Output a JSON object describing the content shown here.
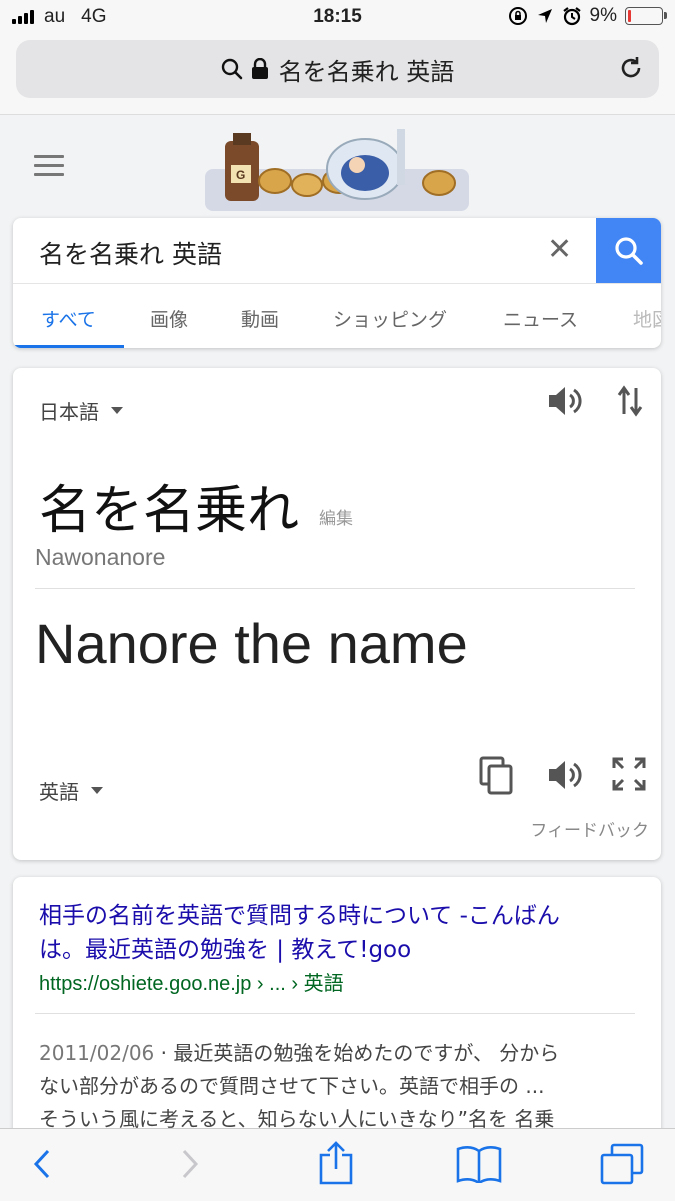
{
  "status": {
    "carrier": "au",
    "network": "4G",
    "time": "18:15",
    "battery": "9%"
  },
  "url_bar": {
    "text": "名を名乗れ 英語"
  },
  "search": {
    "query": "名を名乗れ 英語"
  },
  "tabs": [
    "すべて",
    "画像",
    "動画",
    "ショッピング",
    "ニュース",
    "地図"
  ],
  "translate": {
    "source_lang": "日本語",
    "source_text": "名を名乗れ",
    "edit_label": "編集",
    "romanization": "Nawonanore",
    "target_text": "Nanore the name",
    "target_lang": "英語",
    "feedback": "フィードバック"
  },
  "result": {
    "title_line1": "相手の名前を英語で質問する時について -こんばん",
    "title_line2": "は。最近英語の勉強を | 教えて!goo",
    "url_host": "https://oshiete.goo.ne.jp",
    "url_rest": " › ... › 英語",
    "date": "2011/02/06",
    "snippet_line1": " · 最近英語の勉強を始めたのですが、 分から",
    "snippet_line2": "ない部分があるので質問させて下さい。英語で相手の ...",
    "snippet_line3": "そういう風に考えると、知らない人にいきなり”名を 名乗"
  },
  "colors": {
    "accent": "#1a73e8",
    "search_button": "#4285f4",
    "link": "#1a0dab",
    "url": "#006621"
  }
}
